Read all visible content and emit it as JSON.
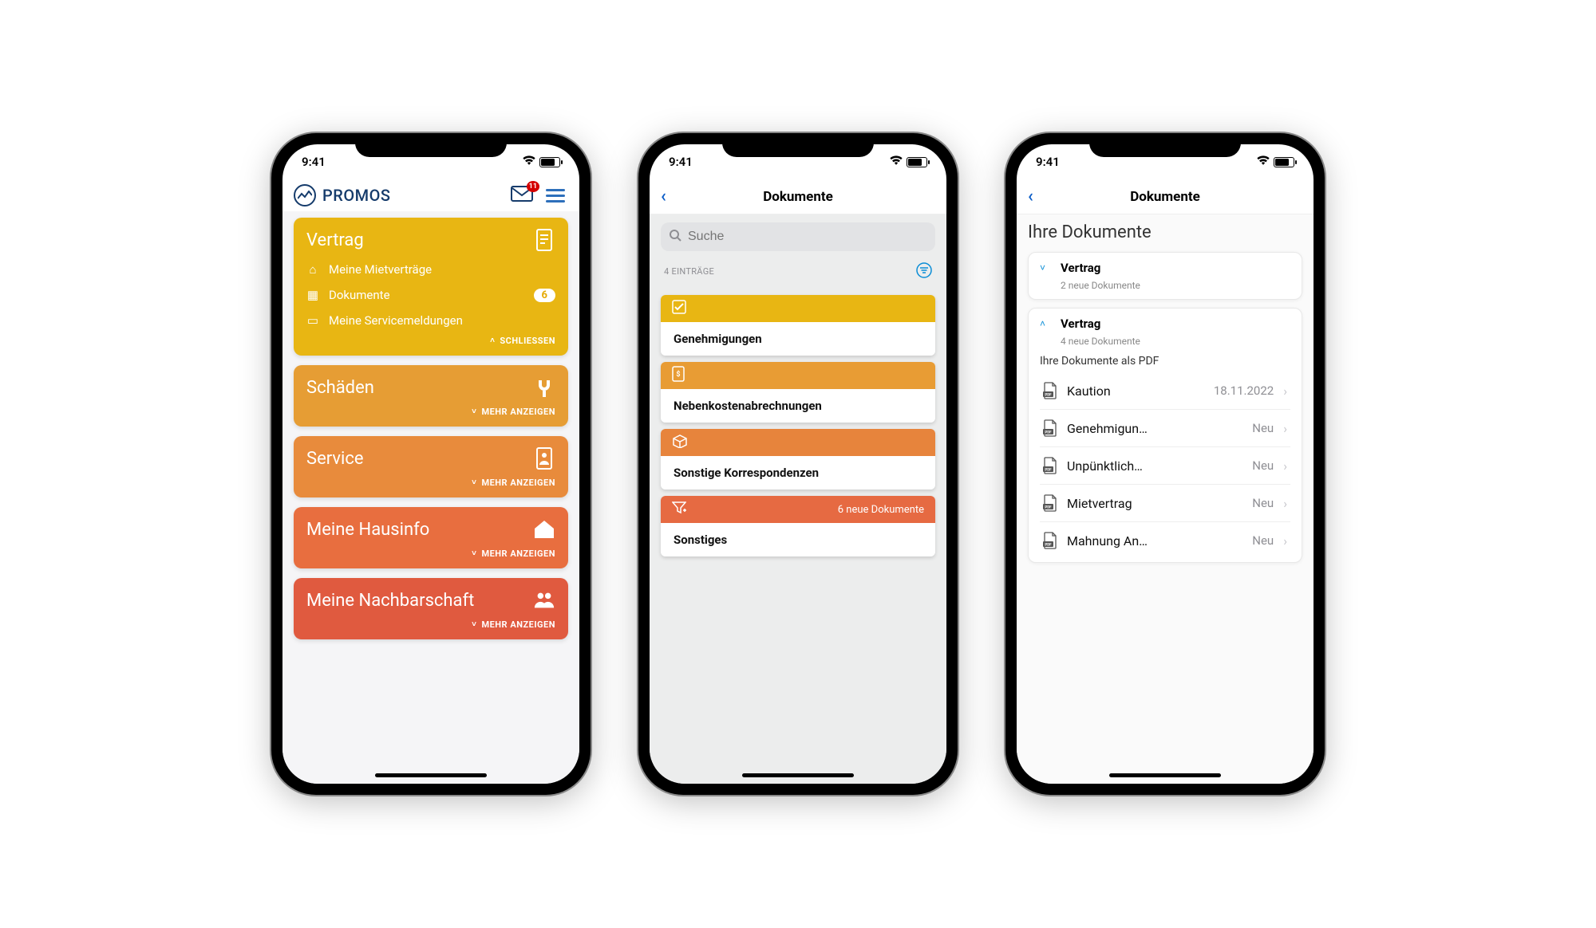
{
  "status": {
    "time": "9:41"
  },
  "phone1": {
    "brand": "PROMOS",
    "mail_badge": "11",
    "cards": [
      {
        "title": "Vertrag",
        "color": "#e8b613",
        "expanded": true,
        "close_label": "SCHLIESSEN",
        "rows": [
          {
            "icon": "home",
            "label": "Meine Mietverträge"
          },
          {
            "icon": "doc",
            "label": "Dokumente",
            "badge": "6"
          },
          {
            "icon": "brief",
            "label": "Meine Servicemeldungen"
          }
        ]
      },
      {
        "title": "Schäden",
        "color": "#e69d34",
        "expand_label": "MEHR ANZEIGEN",
        "icon": "wrench"
      },
      {
        "title": "Service",
        "color": "#e88b3c",
        "expand_label": "MEHR ANZEIGEN",
        "icon": "contact"
      },
      {
        "title": "Meine Hausinfo",
        "color": "#e86e3f",
        "expand_label": "MEHR ANZEIGEN",
        "icon": "house"
      },
      {
        "title": "Meine Nachbarschaft",
        "color": "#e05a3f",
        "expand_label": "MEHR ANZEIGEN",
        "icon": "people"
      }
    ]
  },
  "phone2": {
    "title": "Dokumente",
    "search_placeholder": "Suche",
    "entries_label": "4 EINTRÄGE",
    "categories": [
      {
        "color": "#e8b613",
        "icon": "check",
        "label": "Genehmigungen"
      },
      {
        "color": "#e89c34",
        "icon": "invoice",
        "label": "Nebenkostenabrechnungen"
      },
      {
        "color": "#e7843c",
        "icon": "box",
        "label": "Sonstige Korrespondenzen"
      },
      {
        "color": "#e66a42",
        "icon": "filter",
        "label": "Sonstiges",
        "right": "6  neue Dokumente"
      }
    ]
  },
  "phone3": {
    "title": "Dokumente",
    "section": "Ihre Dokumente",
    "accordions": [
      {
        "title": "Vertrag",
        "sub": "2 neue Dokumente",
        "open": false
      },
      {
        "title": "Vertrag",
        "sub": "4 neue Dokumente",
        "open": true
      }
    ],
    "pdf_header": "Ihre Dokumente als PDF",
    "docs": [
      {
        "name": "Kaution",
        "meta": "18.11.2022"
      },
      {
        "name": "Genehmigun…",
        "meta": "Neu"
      },
      {
        "name": "Unpünktlich…",
        "meta": "Neu"
      },
      {
        "name": "Mietvertrag",
        "meta": "Neu"
      },
      {
        "name": "Mahnung An…",
        "meta": "Neu"
      }
    ]
  }
}
